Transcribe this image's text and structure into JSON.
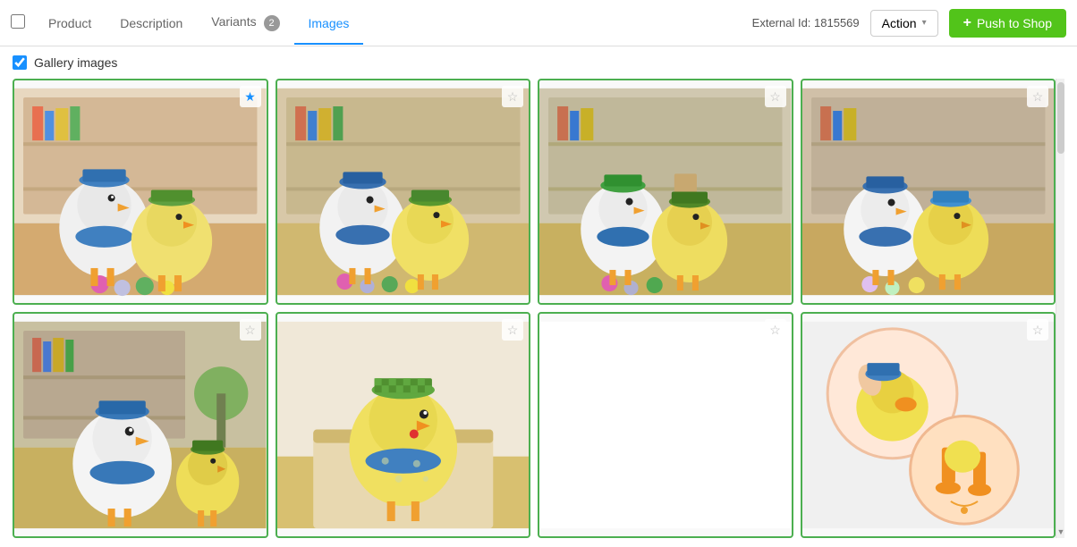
{
  "tabs": [
    {
      "id": "product",
      "label": "Product",
      "active": false
    },
    {
      "id": "description",
      "label": "Description",
      "active": false
    },
    {
      "id": "variants",
      "label": "Variants",
      "active": false,
      "badge": "2"
    },
    {
      "id": "images",
      "label": "Images",
      "active": true
    }
  ],
  "header": {
    "external_id_label": "External Id: 1815569",
    "action_label": "Action",
    "push_label": "Push to Shop"
  },
  "gallery": {
    "section_label": "Gallery images",
    "checked": true,
    "images": [
      {
        "id": 1,
        "starred": true,
        "empty": false,
        "type": "toy-1"
      },
      {
        "id": 2,
        "starred": false,
        "empty": false,
        "type": "toy-2"
      },
      {
        "id": 3,
        "starred": false,
        "empty": false,
        "type": "toy-3"
      },
      {
        "id": 4,
        "starred": false,
        "empty": false,
        "type": "toy-4"
      },
      {
        "id": 5,
        "starred": false,
        "empty": false,
        "type": "toy-5"
      },
      {
        "id": 6,
        "starred": false,
        "empty": false,
        "type": "toy-6"
      },
      {
        "id": 7,
        "starred": false,
        "empty": true,
        "type": "empty"
      },
      {
        "id": 8,
        "starred": false,
        "empty": false,
        "type": "toy-detail"
      }
    ]
  },
  "icons": {
    "star_filled": "★",
    "star_empty": "☆",
    "chevron_down": "▾",
    "plus": "+",
    "scroll_up": "▲",
    "scroll_down": "▼"
  }
}
